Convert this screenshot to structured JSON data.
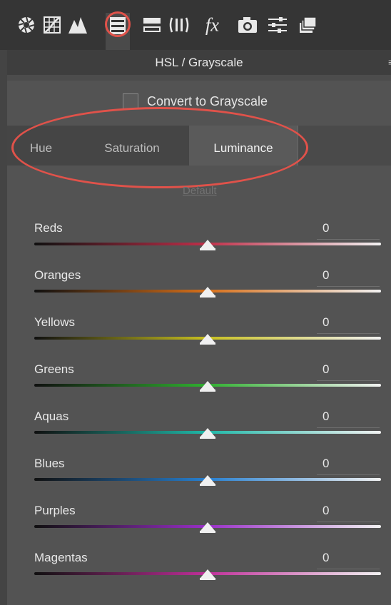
{
  "toolbar": {
    "tools": [
      {
        "name": "basic-icon"
      },
      {
        "name": "tone-curve-icon"
      },
      {
        "name": "detail-icon"
      },
      {
        "name": "hsl-grayscale-icon",
        "active": true
      },
      {
        "name": "split-toning-icon"
      },
      {
        "name": "lens-corrections-icon"
      },
      {
        "name": "effects-fx-icon"
      },
      {
        "name": "camera-calibration-icon"
      },
      {
        "name": "presets-icon"
      },
      {
        "name": "snapshots-icon"
      }
    ]
  },
  "panel": {
    "title": "HSL / Grayscale",
    "convert_label": "Convert to Grayscale",
    "convert_checked": false,
    "tabs": [
      "Hue",
      "Saturation",
      "Luminance"
    ],
    "active_tab": "Luminance",
    "default_link": "Default"
  },
  "sliders": [
    {
      "label": "Reds",
      "value": "0",
      "color": "#c0304a"
    },
    {
      "label": "Oranges",
      "value": "0",
      "color": "#d8701a"
    },
    {
      "label": "Yellows",
      "value": "0",
      "color": "#c8c020"
    },
    {
      "label": "Greens",
      "value": "0",
      "color": "#30b030"
    },
    {
      "label": "Aquas",
      "value": "0",
      "color": "#20b8a8"
    },
    {
      "label": "Blues",
      "value": "0",
      "color": "#2880d0"
    },
    {
      "label": "Purples",
      "value": "0",
      "color": "#9a30c8"
    },
    {
      "label": "Magentas",
      "value": "0",
      "color": "#c0309a"
    }
  ],
  "colors": {
    "highlight": "#e0524a"
  }
}
